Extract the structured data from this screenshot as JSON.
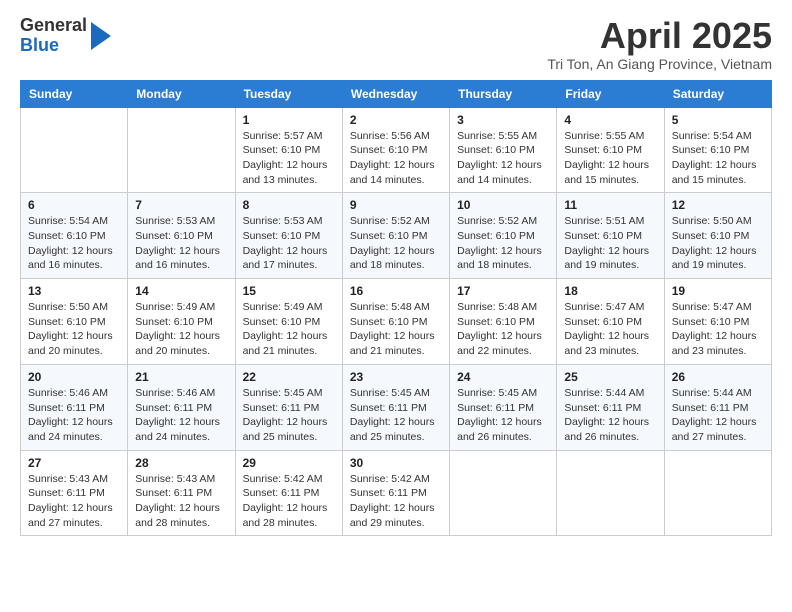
{
  "logo": {
    "general": "General",
    "blue": "Blue"
  },
  "title": "April 2025",
  "subtitle": "Tri Ton, An Giang Province, Vietnam",
  "weekdays": [
    "Sunday",
    "Monday",
    "Tuesday",
    "Wednesday",
    "Thursday",
    "Friday",
    "Saturday"
  ],
  "weeks": [
    [
      {
        "day": "",
        "info": ""
      },
      {
        "day": "",
        "info": ""
      },
      {
        "day": "1",
        "info": "Sunrise: 5:57 AM\nSunset: 6:10 PM\nDaylight: 12 hours and 13 minutes."
      },
      {
        "day": "2",
        "info": "Sunrise: 5:56 AM\nSunset: 6:10 PM\nDaylight: 12 hours and 14 minutes."
      },
      {
        "day": "3",
        "info": "Sunrise: 5:55 AM\nSunset: 6:10 PM\nDaylight: 12 hours and 14 minutes."
      },
      {
        "day": "4",
        "info": "Sunrise: 5:55 AM\nSunset: 6:10 PM\nDaylight: 12 hours and 15 minutes."
      },
      {
        "day": "5",
        "info": "Sunrise: 5:54 AM\nSunset: 6:10 PM\nDaylight: 12 hours and 15 minutes."
      }
    ],
    [
      {
        "day": "6",
        "info": "Sunrise: 5:54 AM\nSunset: 6:10 PM\nDaylight: 12 hours and 16 minutes."
      },
      {
        "day": "7",
        "info": "Sunrise: 5:53 AM\nSunset: 6:10 PM\nDaylight: 12 hours and 16 minutes."
      },
      {
        "day": "8",
        "info": "Sunrise: 5:53 AM\nSunset: 6:10 PM\nDaylight: 12 hours and 17 minutes."
      },
      {
        "day": "9",
        "info": "Sunrise: 5:52 AM\nSunset: 6:10 PM\nDaylight: 12 hours and 18 minutes."
      },
      {
        "day": "10",
        "info": "Sunrise: 5:52 AM\nSunset: 6:10 PM\nDaylight: 12 hours and 18 minutes."
      },
      {
        "day": "11",
        "info": "Sunrise: 5:51 AM\nSunset: 6:10 PM\nDaylight: 12 hours and 19 minutes."
      },
      {
        "day": "12",
        "info": "Sunrise: 5:50 AM\nSunset: 6:10 PM\nDaylight: 12 hours and 19 minutes."
      }
    ],
    [
      {
        "day": "13",
        "info": "Sunrise: 5:50 AM\nSunset: 6:10 PM\nDaylight: 12 hours and 20 minutes."
      },
      {
        "day": "14",
        "info": "Sunrise: 5:49 AM\nSunset: 6:10 PM\nDaylight: 12 hours and 20 minutes."
      },
      {
        "day": "15",
        "info": "Sunrise: 5:49 AM\nSunset: 6:10 PM\nDaylight: 12 hours and 21 minutes."
      },
      {
        "day": "16",
        "info": "Sunrise: 5:48 AM\nSunset: 6:10 PM\nDaylight: 12 hours and 21 minutes."
      },
      {
        "day": "17",
        "info": "Sunrise: 5:48 AM\nSunset: 6:10 PM\nDaylight: 12 hours and 22 minutes."
      },
      {
        "day": "18",
        "info": "Sunrise: 5:47 AM\nSunset: 6:10 PM\nDaylight: 12 hours and 23 minutes."
      },
      {
        "day": "19",
        "info": "Sunrise: 5:47 AM\nSunset: 6:10 PM\nDaylight: 12 hours and 23 minutes."
      }
    ],
    [
      {
        "day": "20",
        "info": "Sunrise: 5:46 AM\nSunset: 6:11 PM\nDaylight: 12 hours and 24 minutes."
      },
      {
        "day": "21",
        "info": "Sunrise: 5:46 AM\nSunset: 6:11 PM\nDaylight: 12 hours and 24 minutes."
      },
      {
        "day": "22",
        "info": "Sunrise: 5:45 AM\nSunset: 6:11 PM\nDaylight: 12 hours and 25 minutes."
      },
      {
        "day": "23",
        "info": "Sunrise: 5:45 AM\nSunset: 6:11 PM\nDaylight: 12 hours and 25 minutes."
      },
      {
        "day": "24",
        "info": "Sunrise: 5:45 AM\nSunset: 6:11 PM\nDaylight: 12 hours and 26 minutes."
      },
      {
        "day": "25",
        "info": "Sunrise: 5:44 AM\nSunset: 6:11 PM\nDaylight: 12 hours and 26 minutes."
      },
      {
        "day": "26",
        "info": "Sunrise: 5:44 AM\nSunset: 6:11 PM\nDaylight: 12 hours and 27 minutes."
      }
    ],
    [
      {
        "day": "27",
        "info": "Sunrise: 5:43 AM\nSunset: 6:11 PM\nDaylight: 12 hours and 27 minutes."
      },
      {
        "day": "28",
        "info": "Sunrise: 5:43 AM\nSunset: 6:11 PM\nDaylight: 12 hours and 28 minutes."
      },
      {
        "day": "29",
        "info": "Sunrise: 5:42 AM\nSunset: 6:11 PM\nDaylight: 12 hours and 28 minutes."
      },
      {
        "day": "30",
        "info": "Sunrise: 5:42 AM\nSunset: 6:11 PM\nDaylight: 12 hours and 29 minutes."
      },
      {
        "day": "",
        "info": ""
      },
      {
        "day": "",
        "info": ""
      },
      {
        "day": "",
        "info": ""
      }
    ]
  ]
}
